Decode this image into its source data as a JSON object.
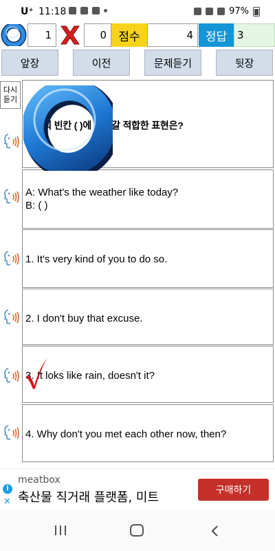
{
  "status_bar": {
    "carrier": "U⁺",
    "time": "11:18",
    "battery": "97%"
  },
  "score_row": {
    "correct_count": "1",
    "wrong_count": "0",
    "score_label": "점수",
    "score_value": "4",
    "answer_label": "정답",
    "answer_value": "3"
  },
  "nav": {
    "first": "앞장",
    "prev": "이전",
    "listen": "문제듣기",
    "next": "뒷장"
  },
  "replay_label_line1": "다시",
  "replay_label_line2": "듣기",
  "question": {
    "text": "대화의 빈칸 ( )에 들어갈 적합한 표현은?",
    "dialog_line1": "A: What's the weather like today?",
    "dialog_line2": "B: ( )"
  },
  "options": [
    "1. It's very kind of you to do so.",
    "2. I don't buy that excuse.",
    "3. It loks like rain, doesn't it?",
    "4. Why don't you met each other now, then?"
  ],
  "feedback": {
    "result_mark": "O",
    "marked_option": 3
  },
  "ad": {
    "brand": "meatbox",
    "slogan": "축산물 직거래 플랫폼, 미트",
    "button": "구매하기"
  },
  "colors": {
    "score_label_bg": "#f7d31c",
    "answer_label_bg": "#1296d6",
    "answer_value_bg": "#e4f6e3",
    "nav_button_bg": "#d3dde9",
    "correct_mark": "#1a5fb4",
    "wrong_mark": "#d61f1f",
    "check_mark": "#d0141a",
    "ad_button": "#c5302a"
  },
  "icons": {
    "correct": "o-mark-icon",
    "wrong": "x-mark-icon",
    "speaker": "speaker-head-icon",
    "check": "red-check-icon",
    "ad_info": "info-icon",
    "ad_close": "close-icon"
  }
}
